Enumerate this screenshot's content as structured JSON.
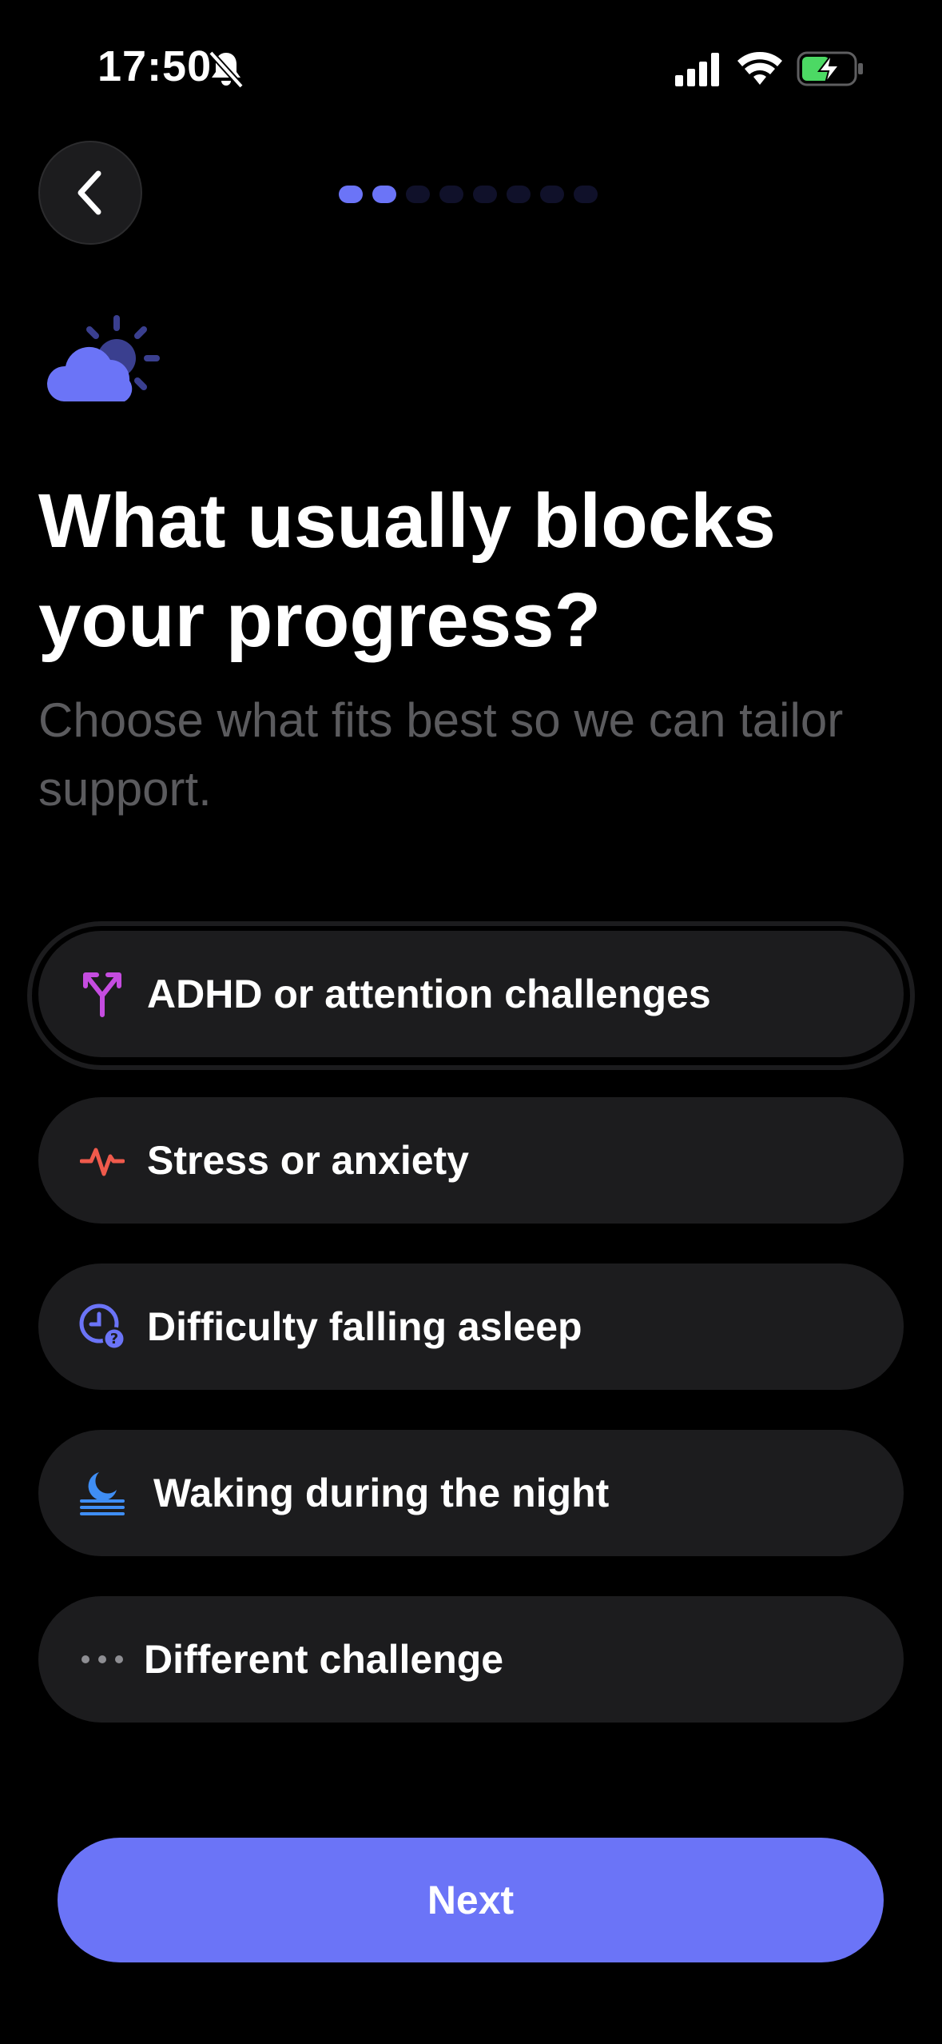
{
  "status_bar": {
    "time": "17:50"
  },
  "header": {
    "progress_total": 8,
    "progress_current": 2
  },
  "main": {
    "title": "What usually blocks your progress?",
    "subtitle": "Choose what fits best so we can tailor support.",
    "options": [
      {
        "label": "ADHD or attention challenges",
        "icon": "fork-arrows-icon",
        "color": "#c54ce0",
        "selected": true
      },
      {
        "label": "Stress or anxiety",
        "icon": "heartbeat-icon",
        "color": "#ef5a4c",
        "selected": false
      },
      {
        "label": "Difficulty falling asleep",
        "icon": "clock-question-icon",
        "color": "#6b74f7",
        "selected": false
      },
      {
        "label": "Waking during the night",
        "icon": "moon-horizon-icon",
        "color": "#3f8ef5",
        "selected": false
      },
      {
        "label": "Different challenge",
        "icon": "more-dots-icon",
        "color": "#8e8e93",
        "selected": false
      }
    ]
  },
  "footer": {
    "next_label": "Next"
  },
  "colors": {
    "accent": "#6b74f7",
    "card": "#1c1c1e",
    "background": "#000000"
  }
}
